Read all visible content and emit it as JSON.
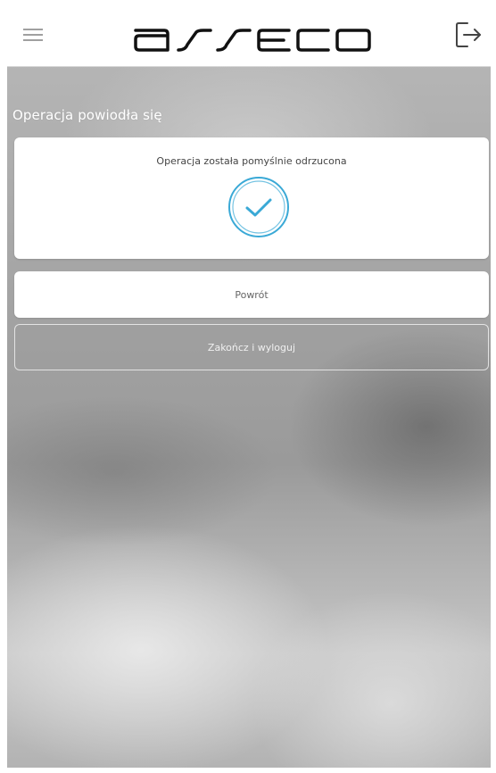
{
  "header": {
    "logo_text": "asseco",
    "menu_icon": "hamburger-menu-icon",
    "logout_icon": "logout-icon"
  },
  "main": {
    "section_title": "Operacja powiodła się",
    "result_card": {
      "message": "Operacja została pomyślnie odrzucona",
      "icon": "checkmark-circle-icon",
      "icon_color": "#3aa9d6"
    },
    "buttons": {
      "back_label": "Powrót",
      "finish_logout_label": "Zakończ i wyloguj"
    }
  }
}
